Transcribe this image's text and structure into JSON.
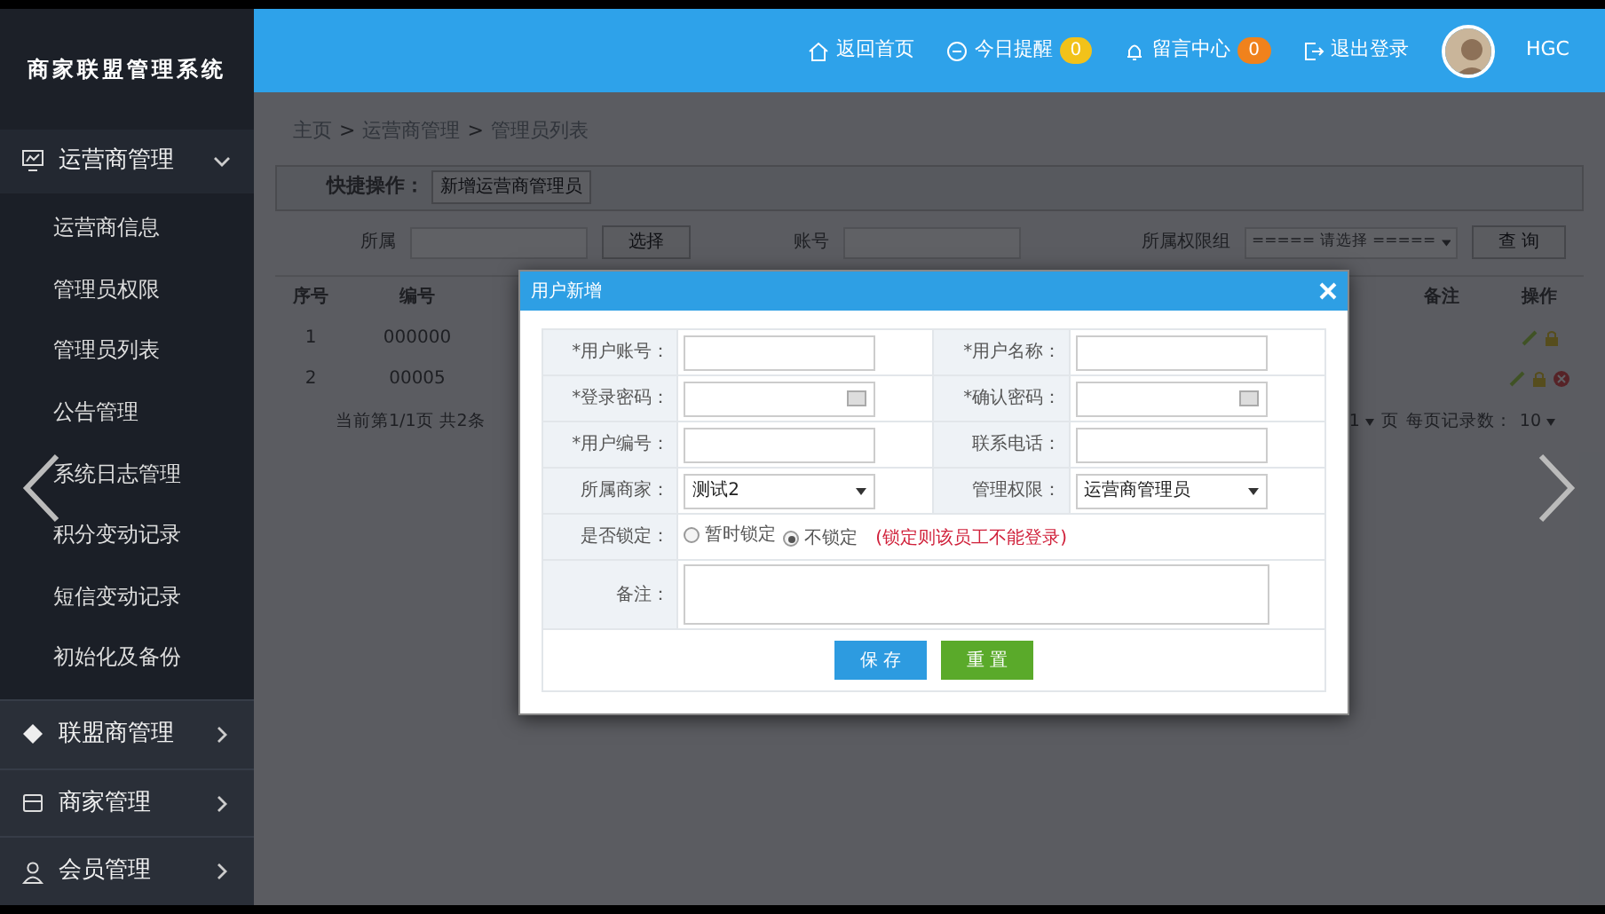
{
  "sidebar": {
    "logo": "商家联盟管理系统",
    "groups": [
      {
        "label": "运营商管理",
        "expanded": true,
        "children": [
          {
            "label": "运营商信息"
          },
          {
            "label": "管理员权限"
          },
          {
            "label": "管理员列表"
          },
          {
            "label": "公告管理"
          },
          {
            "label": "系统日志管理"
          },
          {
            "label": "积分变动记录"
          },
          {
            "label": "短信变动记录"
          },
          {
            "label": "初始化及备份"
          }
        ]
      },
      {
        "label": "联盟商管理",
        "expanded": false
      },
      {
        "label": "商家管理",
        "expanded": false
      },
      {
        "label": "会员管理",
        "expanded": false
      }
    ]
  },
  "header": {
    "nav": [
      {
        "label": "返回首页"
      },
      {
        "label": "今日提醒",
        "badge": "0",
        "color": "#f2c21a"
      },
      {
        "label": "留言中心",
        "badge": "0",
        "color": "#f0821c"
      },
      {
        "label": "退出登录"
      }
    ],
    "user": "HGC"
  },
  "breadcrumb": {
    "items": [
      "主页",
      "运营商管理",
      "管理员列表"
    ],
    "separator": ">"
  },
  "quick_actions": {
    "label": "快捷操作：",
    "button": "新增运营商管理员"
  },
  "filter": {
    "owner_label": "所属",
    "select_button": "选择",
    "account_label": "账号",
    "group_label": "所属权限组",
    "group_value": "===== 请选择 =====",
    "search_button": "查 询"
  },
  "table": {
    "left_columns": [
      "序号",
      "编号"
    ],
    "right_columns": [
      "备注",
      "操作"
    ],
    "rows": [
      {
        "cells": [
          "1",
          "000000"
        ],
        "deletable": false
      },
      {
        "cells": [
          "2",
          "00005"
        ],
        "deletable": true
      }
    ],
    "pagination": {
      "summary": "当前第1/1页 共2条",
      "page_value": "1",
      "page_suffix": "页",
      "per_page_label": "每页记录数：",
      "per_page": "10"
    }
  },
  "dialog": {
    "title": "用户新增",
    "rows": [
      [
        {
          "label": "*用户账号：",
          "kind": "text"
        },
        {
          "label": "*用户名称：",
          "kind": "text"
        }
      ],
      [
        {
          "label": "*登录密码：",
          "kind": "password"
        },
        {
          "label": "*确认密码：",
          "kind": "password"
        }
      ],
      [
        {
          "label": "*用户编号：",
          "kind": "text"
        },
        {
          "label": "联系电话：",
          "kind": "text"
        }
      ],
      [
        {
          "label": "所属商家：",
          "kind": "select",
          "value": "测试2"
        },
        {
          "label": "管理权限：",
          "kind": "select",
          "value": "运营商管理员"
        }
      ]
    ],
    "lock": {
      "label": "是否锁定：",
      "options": [
        {
          "label": "暂时锁定",
          "selected": false
        },
        {
          "label": "不锁定",
          "selected": true
        }
      ],
      "note": "(锁定则该员工不能登录)"
    },
    "remark": {
      "label": "备注："
    },
    "buttons": [
      {
        "label": "保 存",
        "kind": "save"
      },
      {
        "label": "重 置",
        "kind": "reset"
      }
    ]
  }
}
